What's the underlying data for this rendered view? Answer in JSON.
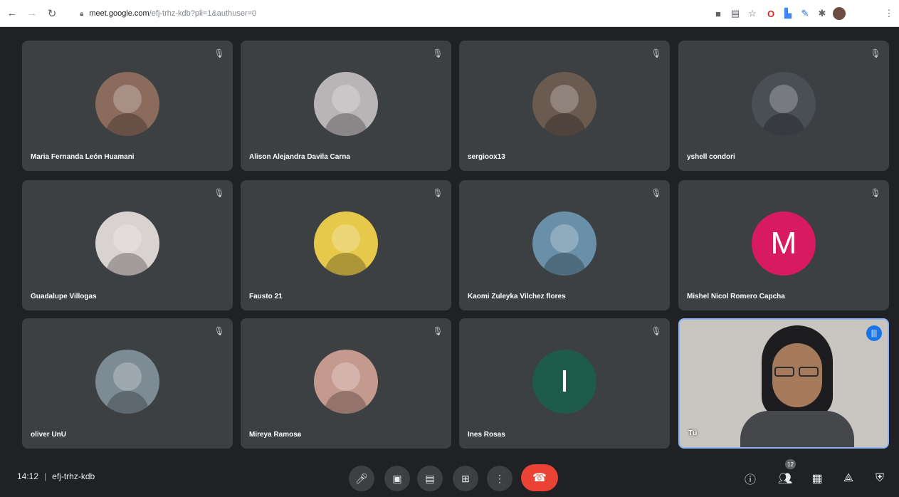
{
  "browser": {
    "url_host": "meet.google.com",
    "url_path": "/efj-trhz-kdb?pli=1&authuser=0",
    "icons": [
      "back-icon",
      "forward-icon",
      "reload-icon",
      "lock-icon",
      "camera-blocked-icon",
      "reader-icon",
      "star-icon",
      "opera-icon",
      "docs-icon",
      "pen-icon",
      "extensions-icon",
      "profile-avatar",
      "menu-dots-icon"
    ]
  },
  "participants": [
    {
      "name": "Maria Fernanda León Huamani",
      "avatar_type": "photo",
      "color": "#8b6b5c"
    },
    {
      "name": "Alison Alejandra Davila Carna",
      "avatar_type": "photo",
      "color": "#b9b4b6"
    },
    {
      "name": "sergioox13",
      "avatar_type": "photo",
      "color": "#6b5a50"
    },
    {
      "name": "yshell condori",
      "avatar_type": "photo",
      "color": "#4a4e55"
    },
    {
      "name": "Guadalupe Villogas",
      "avatar_type": "photo",
      "color": "#d8d2d0"
    },
    {
      "name": "Fausto 21",
      "avatar_type": "photo",
      "color": "#e6c84a"
    },
    {
      "name": "Kaomi Zuleyka Vilchez flores",
      "avatar_type": "photo",
      "color": "#6a8fa8"
    },
    {
      "name": "Mishel Nicol Romero Capcha",
      "avatar_type": "letter",
      "letter": "M",
      "color": "#d81b60"
    },
    {
      "name": "oliver UnU",
      "avatar_type": "photo",
      "color": "#7d8c94"
    },
    {
      "name": "Mireya Ramosɕ",
      "avatar_type": "photo",
      "color": "#c49a8e"
    },
    {
      "name": "Ines Rosas",
      "avatar_type": "letter",
      "letter": "I",
      "color": "#1e5b4a"
    }
  ],
  "self_tile": {
    "name": "Tú"
  },
  "footer": {
    "time": "14:12",
    "meeting_code": "efj-trhz-kdb",
    "participant_count": "12"
  }
}
